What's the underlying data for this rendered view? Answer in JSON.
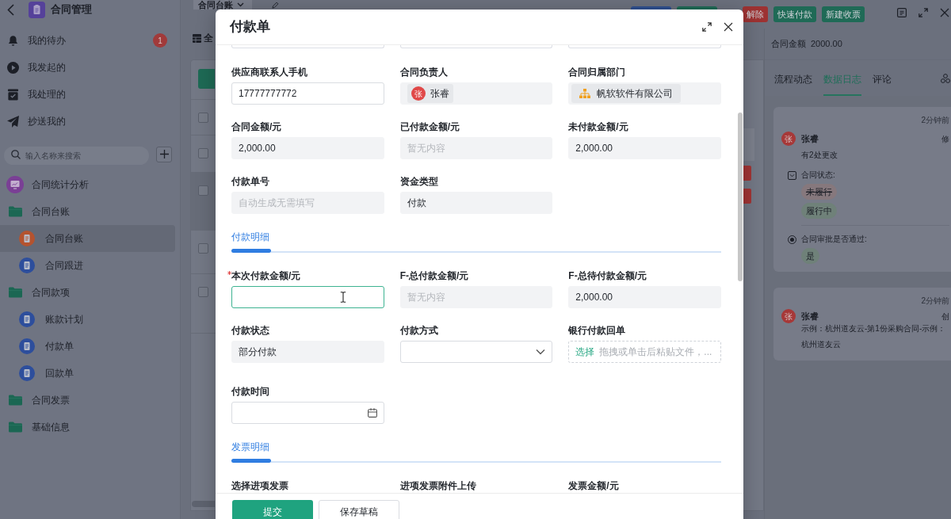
{
  "sidebar": {
    "title": "合同管理",
    "nav": [
      {
        "label": "我的待办",
        "badge": "1",
        "selected": false
      },
      {
        "label": "我发起的",
        "selected": false
      },
      {
        "label": "我处理的",
        "selected": false
      },
      {
        "label": "抄送我的",
        "selected": false
      }
    ],
    "search": {
      "placeholder": "输入名称来搜索"
    },
    "tree": [
      {
        "label": "合同统计分析",
        "kind": "dashboard",
        "selected": false
      },
      {
        "label": "合同台账",
        "kind": "folder",
        "selected": false,
        "children": [
          {
            "label": "合同台账",
            "kind": "form",
            "color": "#b4532f",
            "selected": true
          },
          {
            "label": "合同跟进",
            "kind": "form",
            "color": "#2d4e9c",
            "selected": false
          }
        ]
      },
      {
        "label": "合同款项",
        "kind": "folder",
        "selected": false,
        "children": [
          {
            "label": "账款计划",
            "kind": "form",
            "color": "#2d4e9c",
            "selected": false
          },
          {
            "label": "付款单",
            "kind": "form",
            "color": "#2d4e9c",
            "selected": false
          },
          {
            "label": "回款单",
            "kind": "form",
            "color": "#2d4e9c",
            "selected": false
          }
        ]
      },
      {
        "label": "合同发票",
        "kind": "folder",
        "selected": false
      },
      {
        "label": "基础信息",
        "kind": "folder",
        "selected": false
      }
    ]
  },
  "toolbar": {
    "tab": "合同台账",
    "buttons": [
      {
        "color": "#2f4f8f"
      },
      {
        "color": "#1f6a56"
      },
      {
        "label": "解除",
        "color": "#9d3232"
      },
      {
        "label": "快速付款",
        "color": "#1f6a56"
      },
      {
        "label": "新建收票",
        "color": "#1f6a56"
      }
    ]
  },
  "view": {
    "label": "全"
  },
  "table": {
    "rows": [
      {
        "checked": false,
        "highlighted": false,
        "tag": false
      },
      {
        "checked": false,
        "highlighted": false,
        "tag": true
      },
      {
        "checked": false,
        "highlighted": true,
        "tag": true
      },
      {
        "checked": false,
        "highlighted": false,
        "tag": false
      },
      {
        "checked": false,
        "highlighted": false,
        "tag": false
      }
    ]
  },
  "detail": {
    "amount": {
      "label": "合同金额",
      "value": "2000.00"
    },
    "tabs": [
      {
        "label": "流程动态",
        "selected": false
      },
      {
        "label": "数据日志",
        "selected": true
      },
      {
        "label": "评论",
        "selected": false
      }
    ],
    "log": [
      {
        "time": "2分钟前",
        "avatar": "张",
        "user": "张睿",
        "action": "修",
        "summary": "有2处更改",
        "changes": [
          {
            "kind": "select",
            "field": "合同状态:",
            "old": "未履行",
            "new": "履行中"
          },
          {
            "kind": "radio",
            "field": "合同审批是否通过:",
            "new": "是"
          }
        ]
      },
      {
        "time": "2分钟前",
        "avatar": "张",
        "user": "张睿",
        "action": "创",
        "text": "示例：杭州道友云-第1份采购合同-示例：杭州道友云"
      }
    ]
  },
  "modal": {
    "title": "付款单",
    "groups": [
      {
        "fields": [
          {
            "kind": "cut"
          },
          {
            "kind": "cut"
          },
          {
            "kind": "cut"
          },
          {
            "kind": "input",
            "label": "供应商联系人手机",
            "value": "17777777772",
            "required": false,
            "focused": false,
            "hovered": false
          },
          {
            "kind": "person",
            "label": "合同负责人",
            "avatar": "张",
            "value": "张睿",
            "required": false,
            "focused": false,
            "hovered": false
          },
          {
            "kind": "department",
            "label": "合同归属部门",
            "value": "帆软软件有限公司",
            "required": false,
            "focused": false,
            "hovered": false
          },
          {
            "kind": "readonly",
            "label": "合同金额/元",
            "value": "2,000.00",
            "required": false,
            "focused": false,
            "hovered": false
          },
          {
            "kind": "readonly",
            "label": "已付款金额/元",
            "placeholder": "暂无内容",
            "required": false,
            "focused": false,
            "hovered": false
          },
          {
            "kind": "readonly",
            "label": "未付款金额/元",
            "value": "2,000.00",
            "required": false,
            "focused": false,
            "hovered": false
          },
          {
            "kind": "readonly",
            "label": "付款单号",
            "placeholder": "自动生成无需填写",
            "required": false,
            "focused": false,
            "hovered": false
          },
          {
            "kind": "readonly",
            "label": "资金类型",
            "value": "付款",
            "required": false,
            "focused": false,
            "hovered": false
          }
        ]
      },
      {
        "title": "付款明细",
        "fields": [
          {
            "kind": "input",
            "label": "本次付款金额/元",
            "required": true,
            "focused": true,
            "hovered": true
          },
          {
            "kind": "readonly",
            "label": "F-总付款金额/元",
            "placeholder": "暂无内容",
            "required": false,
            "focused": false,
            "hovered": false
          },
          {
            "kind": "readonly",
            "label": "F-总待付款金额/元",
            "value": "2,000.00",
            "required": false,
            "focused": false,
            "hovered": false
          },
          {
            "kind": "readonly",
            "label": "付款状态",
            "value": "部分付款",
            "required": false,
            "focused": false,
            "hovered": false
          },
          {
            "kind": "select",
            "label": "付款方式",
            "required": false,
            "focused": false,
            "hovered": false
          },
          {
            "kind": "upload",
            "label": "银行付款回单",
            "action": "选择",
            "hint": "拖拽或单击后粘贴文件，...",
            "required": false,
            "focused": false,
            "hovered": false
          },
          {
            "kind": "date",
            "label": "付款时间",
            "required": false,
            "focused": false,
            "hovered": false
          }
        ]
      },
      {
        "title": "发票明细",
        "fields": [
          {
            "kind": "label_only",
            "label": "选择进项发票",
            "required": false
          },
          {
            "kind": "label_only",
            "label": "进项发票附件上传",
            "required": false
          },
          {
            "kind": "label_only",
            "label": "发票金额/元",
            "required": false
          }
        ]
      }
    ],
    "buttons": [
      {
        "label": "提交",
        "kind": "primary"
      },
      {
        "label": "保存草稿",
        "kind": "secondary"
      }
    ]
  }
}
